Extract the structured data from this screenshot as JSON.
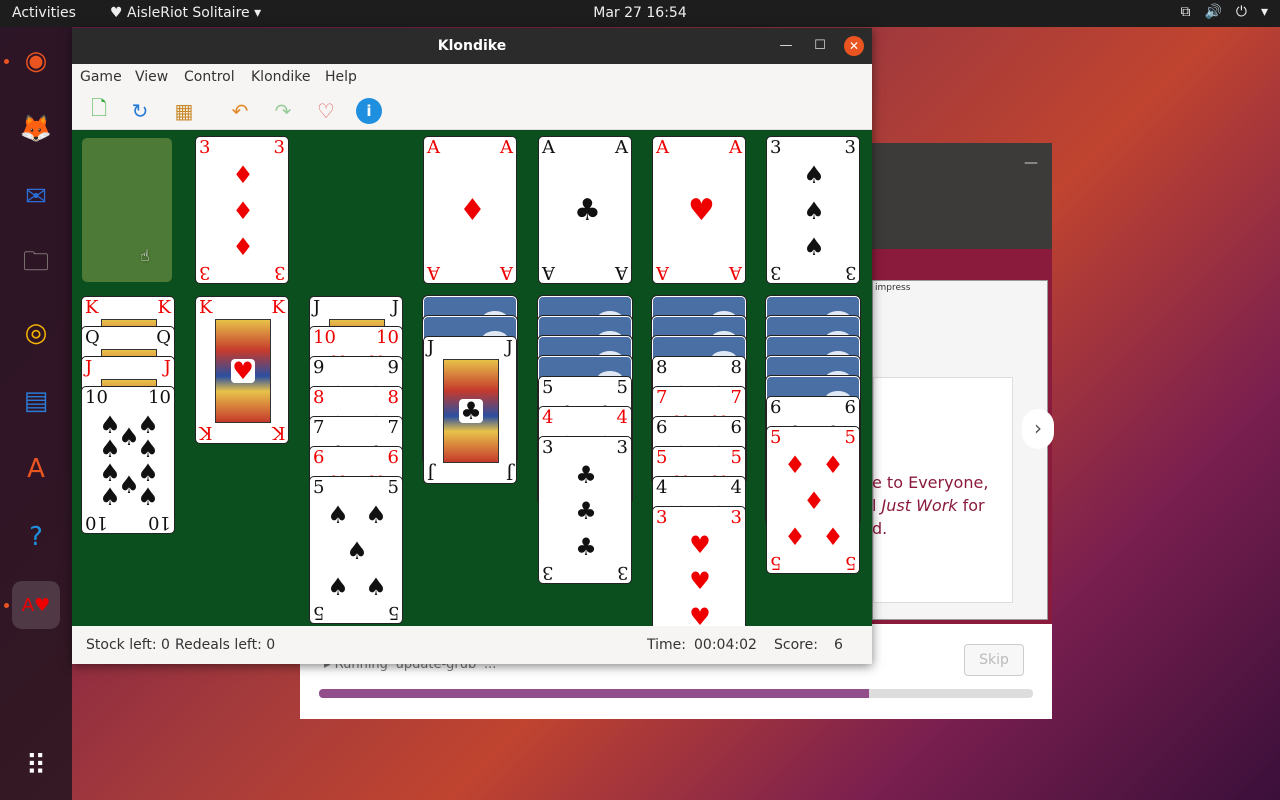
{
  "topbar": {
    "activities": "Activities",
    "app_menu": "♥ AisleRiot Solitaire ▾",
    "clock": "Mar 27  16:54",
    "tray": [
      "⧉",
      "🔊",
      "⏻",
      "▾"
    ]
  },
  "dock": {
    "items": [
      {
        "name": "ubuntu-icon",
        "glyph": "◉",
        "color": "#e95420",
        "running": true
      },
      {
        "name": "firefox-icon",
        "glyph": "🦊",
        "color": "#ff7a1a",
        "running": false
      },
      {
        "name": "thunderbird-icon",
        "glyph": "✉",
        "color": "#2a6dd6",
        "running": false
      },
      {
        "name": "files-icon",
        "glyph": "🗀",
        "color": "#a8a49c",
        "running": false
      },
      {
        "name": "rhythmbox-icon",
        "glyph": "◎",
        "color": "#f4b400",
        "running": false
      },
      {
        "name": "writer-icon",
        "glyph": "▤",
        "color": "#2a7bd6",
        "running": false
      },
      {
        "name": "software-icon",
        "glyph": "A",
        "color": "#e95420",
        "running": false
      },
      {
        "name": "help-icon",
        "glyph": "?",
        "color": "#1f8fe0",
        "running": false
      },
      {
        "name": "aisleriot-icon",
        "glyph": "A♥",
        "color": "#f0f0f0",
        "running": true
      }
    ],
    "grid_glyph": "⠿"
  },
  "background_window": {
    "impress_title": "impress",
    "welcome_line1": "e to Everyone,",
    "welcome_line2_a": "l ",
    "welcome_line2_em": "Just Work",
    "welcome_line2_b": " for",
    "welcome_line3": "d.",
    "status": "▸ Running 'update-grub' ...",
    "skip_label": "Skip",
    "progress": 0.77
  },
  "window": {
    "title": "Klondike",
    "menu": [
      "Game",
      "View",
      "Control",
      "Klondike",
      "Help"
    ],
    "toolbar_icons": [
      "new-game-icon",
      "restart-icon",
      "select-game-icon",
      "undo-icon",
      "redo-icon",
      "hint-icon",
      "info-icon"
    ],
    "status": {
      "stock": "Stock left: 0",
      "redeals": "Redeals left: 0",
      "time_label": "Time:",
      "time": "00:04:02",
      "score_label": "Score:",
      "score": "6"
    }
  },
  "game": {
    "waste": {
      "rank": "3",
      "suit": "♦"
    },
    "foundations": [
      {
        "rank": "A",
        "suit": "♦"
      },
      {
        "rank": "A",
        "suit": "♣"
      },
      {
        "rank": "A",
        "suit": "♥"
      },
      {
        "rank": "3",
        "suit": "♠"
      }
    ],
    "tableau": [
      {
        "hidden": 0,
        "cards": [
          {
            "rank": "K",
            "suit": "♥"
          },
          {
            "rank": "Q",
            "suit": "♣"
          },
          {
            "rank": "J",
            "suit": "♥"
          },
          {
            "rank": "10",
            "suit": "♠"
          }
        ]
      },
      {
        "hidden": 0,
        "cards": [
          {
            "rank": "K",
            "suit": "♥"
          }
        ]
      },
      {
        "hidden": 0,
        "cards": [
          {
            "rank": "J",
            "suit": "♠"
          },
          {
            "rank": "10",
            "suit": "♥"
          },
          {
            "rank": "9",
            "suit": "♠"
          },
          {
            "rank": "8",
            "suit": "♦"
          },
          {
            "rank": "7",
            "suit": "♣"
          },
          {
            "rank": "6",
            "suit": "♥"
          },
          {
            "rank": "5",
            "suit": "♠"
          }
        ]
      },
      {
        "hidden": 2,
        "cards": [
          {
            "rank": "J",
            "suit": "♣"
          }
        ]
      },
      {
        "hidden": 4,
        "cards": [
          {
            "rank": "5",
            "suit": "♣"
          },
          {
            "rank": "4",
            "suit": "♦"
          },
          {
            "rank": "3",
            "suit": "♣"
          }
        ]
      },
      {
        "hidden": 3,
        "cards": [
          {
            "rank": "8",
            "suit": "♠"
          },
          {
            "rank": "7",
            "suit": "♥"
          },
          {
            "rank": "6",
            "suit": "♠"
          },
          {
            "rank": "5",
            "suit": "♥"
          },
          {
            "rank": "4",
            "suit": "♠"
          },
          {
            "rank": "3",
            "suit": "♥"
          }
        ]
      },
      {
        "hidden": 5,
        "cards": [
          {
            "rank": "6",
            "suit": "♣"
          },
          {
            "rank": "5",
            "suit": "♦"
          }
        ]
      }
    ]
  }
}
